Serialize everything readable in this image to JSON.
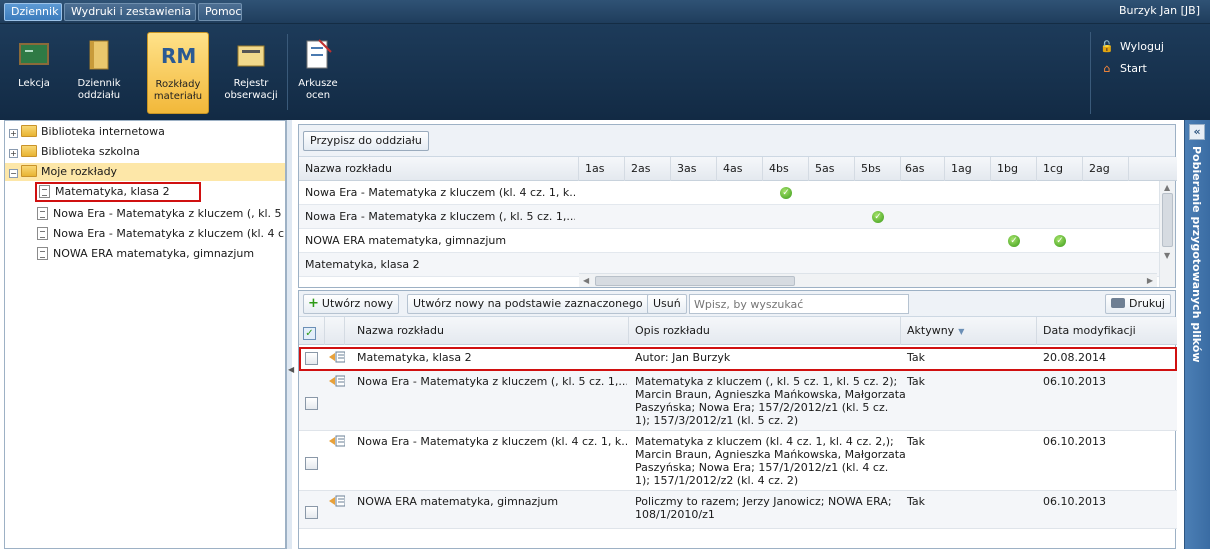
{
  "menu": {
    "tabs": [
      "Dziennik",
      "Wydruki i zestawienia",
      "Pomoc"
    ],
    "user": "Burzyk Jan [JB]"
  },
  "toolbar": {
    "lekcja": "Lekcja",
    "dziennik": "Dziennik oddziału",
    "rozklady": "Rozkłady materiału",
    "rejestr": "Rejestr obserwacji",
    "arkusze": "Arkusze ocen",
    "logout": "Wyloguj",
    "start": "Start",
    "rm_badge": "RM"
  },
  "tree": {
    "items": [
      "Biblioteka internetowa",
      "Biblioteka szkolna",
      "Moje rozkłady",
      "Matematyka, klasa 2",
      "Nowa Era - Matematyka z kluczem (, kl. 5",
      "Nowa Era - Matematyka z kluczem (kl. 4 c",
      "NOWA ERA matematyka, gimnazjum"
    ]
  },
  "top_grid": {
    "assign_button": "Przypisz do oddziału",
    "name_header": "Nazwa rozkładu",
    "columns": [
      "1as",
      "2as",
      "3as",
      "4as",
      "4bs",
      "5as",
      "5bs",
      "6as",
      "1ag",
      "1bg",
      "1cg",
      "2ag"
    ],
    "rows": [
      {
        "name": "Nowa Era - Matematyka z kluczem (kl. 4 cz. 1, k...",
        "checks": [
          "4bs"
        ]
      },
      {
        "name": "Nowa Era - Matematyka z kluczem (, kl. 5 cz. 1,...",
        "checks": [
          "5bs"
        ]
      },
      {
        "name": "NOWA ERA matematyka, gimnazjum",
        "checks": [
          "1bg",
          "1cg"
        ]
      },
      {
        "name": "Matematyka, klasa 2",
        "checks": []
      }
    ]
  },
  "bottom_grid": {
    "toolbar": {
      "new": "Utwórz nowy",
      "new_based": "Utwórz nowy na podstawie zaznaczonego",
      "delete": "Usuń",
      "search_placeholder": "Wpisz, by wyszukać",
      "print": "Drukuj"
    },
    "headers": {
      "name": "Nazwa rozkładu",
      "desc": "Opis rozkładu",
      "active": "Aktywny",
      "modified": "Data modyfikacji"
    },
    "rows": [
      {
        "name": "Matematyka, klasa 2",
        "desc": [
          "Autor: Jan Burzyk"
        ],
        "active": "Tak",
        "modified": "20.08.2014"
      },
      {
        "name": "Nowa Era - Matematyka z kluczem (, kl. 5 cz. 1,...",
        "desc": [
          "Matematyka z kluczem (, kl. 5 cz. 1, kl. 5 cz. 2);",
          "Marcin Braun, Agnieszka Mańkowska, Małgorzata",
          "Paszyńska; Nowa Era; 157/2/2012/z1 (kl. 5 cz.",
          "1); 157/3/2012/z1 (kl. 5 cz. 2)"
        ],
        "active": "Tak",
        "modified": "06.10.2013"
      },
      {
        "name": "Nowa Era - Matematyka z kluczem (kl. 4 cz. 1, k...",
        "desc": [
          "Matematyka z kluczem (kl. 4 cz. 1, kl. 4 cz. 2,);",
          "Marcin Braun, Agnieszka Mańkowska, Małgorzata",
          "Paszyńska; Nowa Era; 157/1/2012/z1 (kl. 4 cz.",
          "1); 157/1/2012/z2 (kl. 4 cz. 2)"
        ],
        "active": "Tak",
        "modified": "06.10.2013"
      },
      {
        "name": "NOWA ERA matematyka, gimnazjum",
        "desc": [
          "Policzmy to razem; Jerzy Janowicz; NOWA ERA;",
          "108/1/2010/z1"
        ],
        "active": "Tak",
        "modified": "06.10.2013"
      }
    ]
  },
  "side_panel": {
    "title": "Pobieranie przygotowanych plików"
  }
}
